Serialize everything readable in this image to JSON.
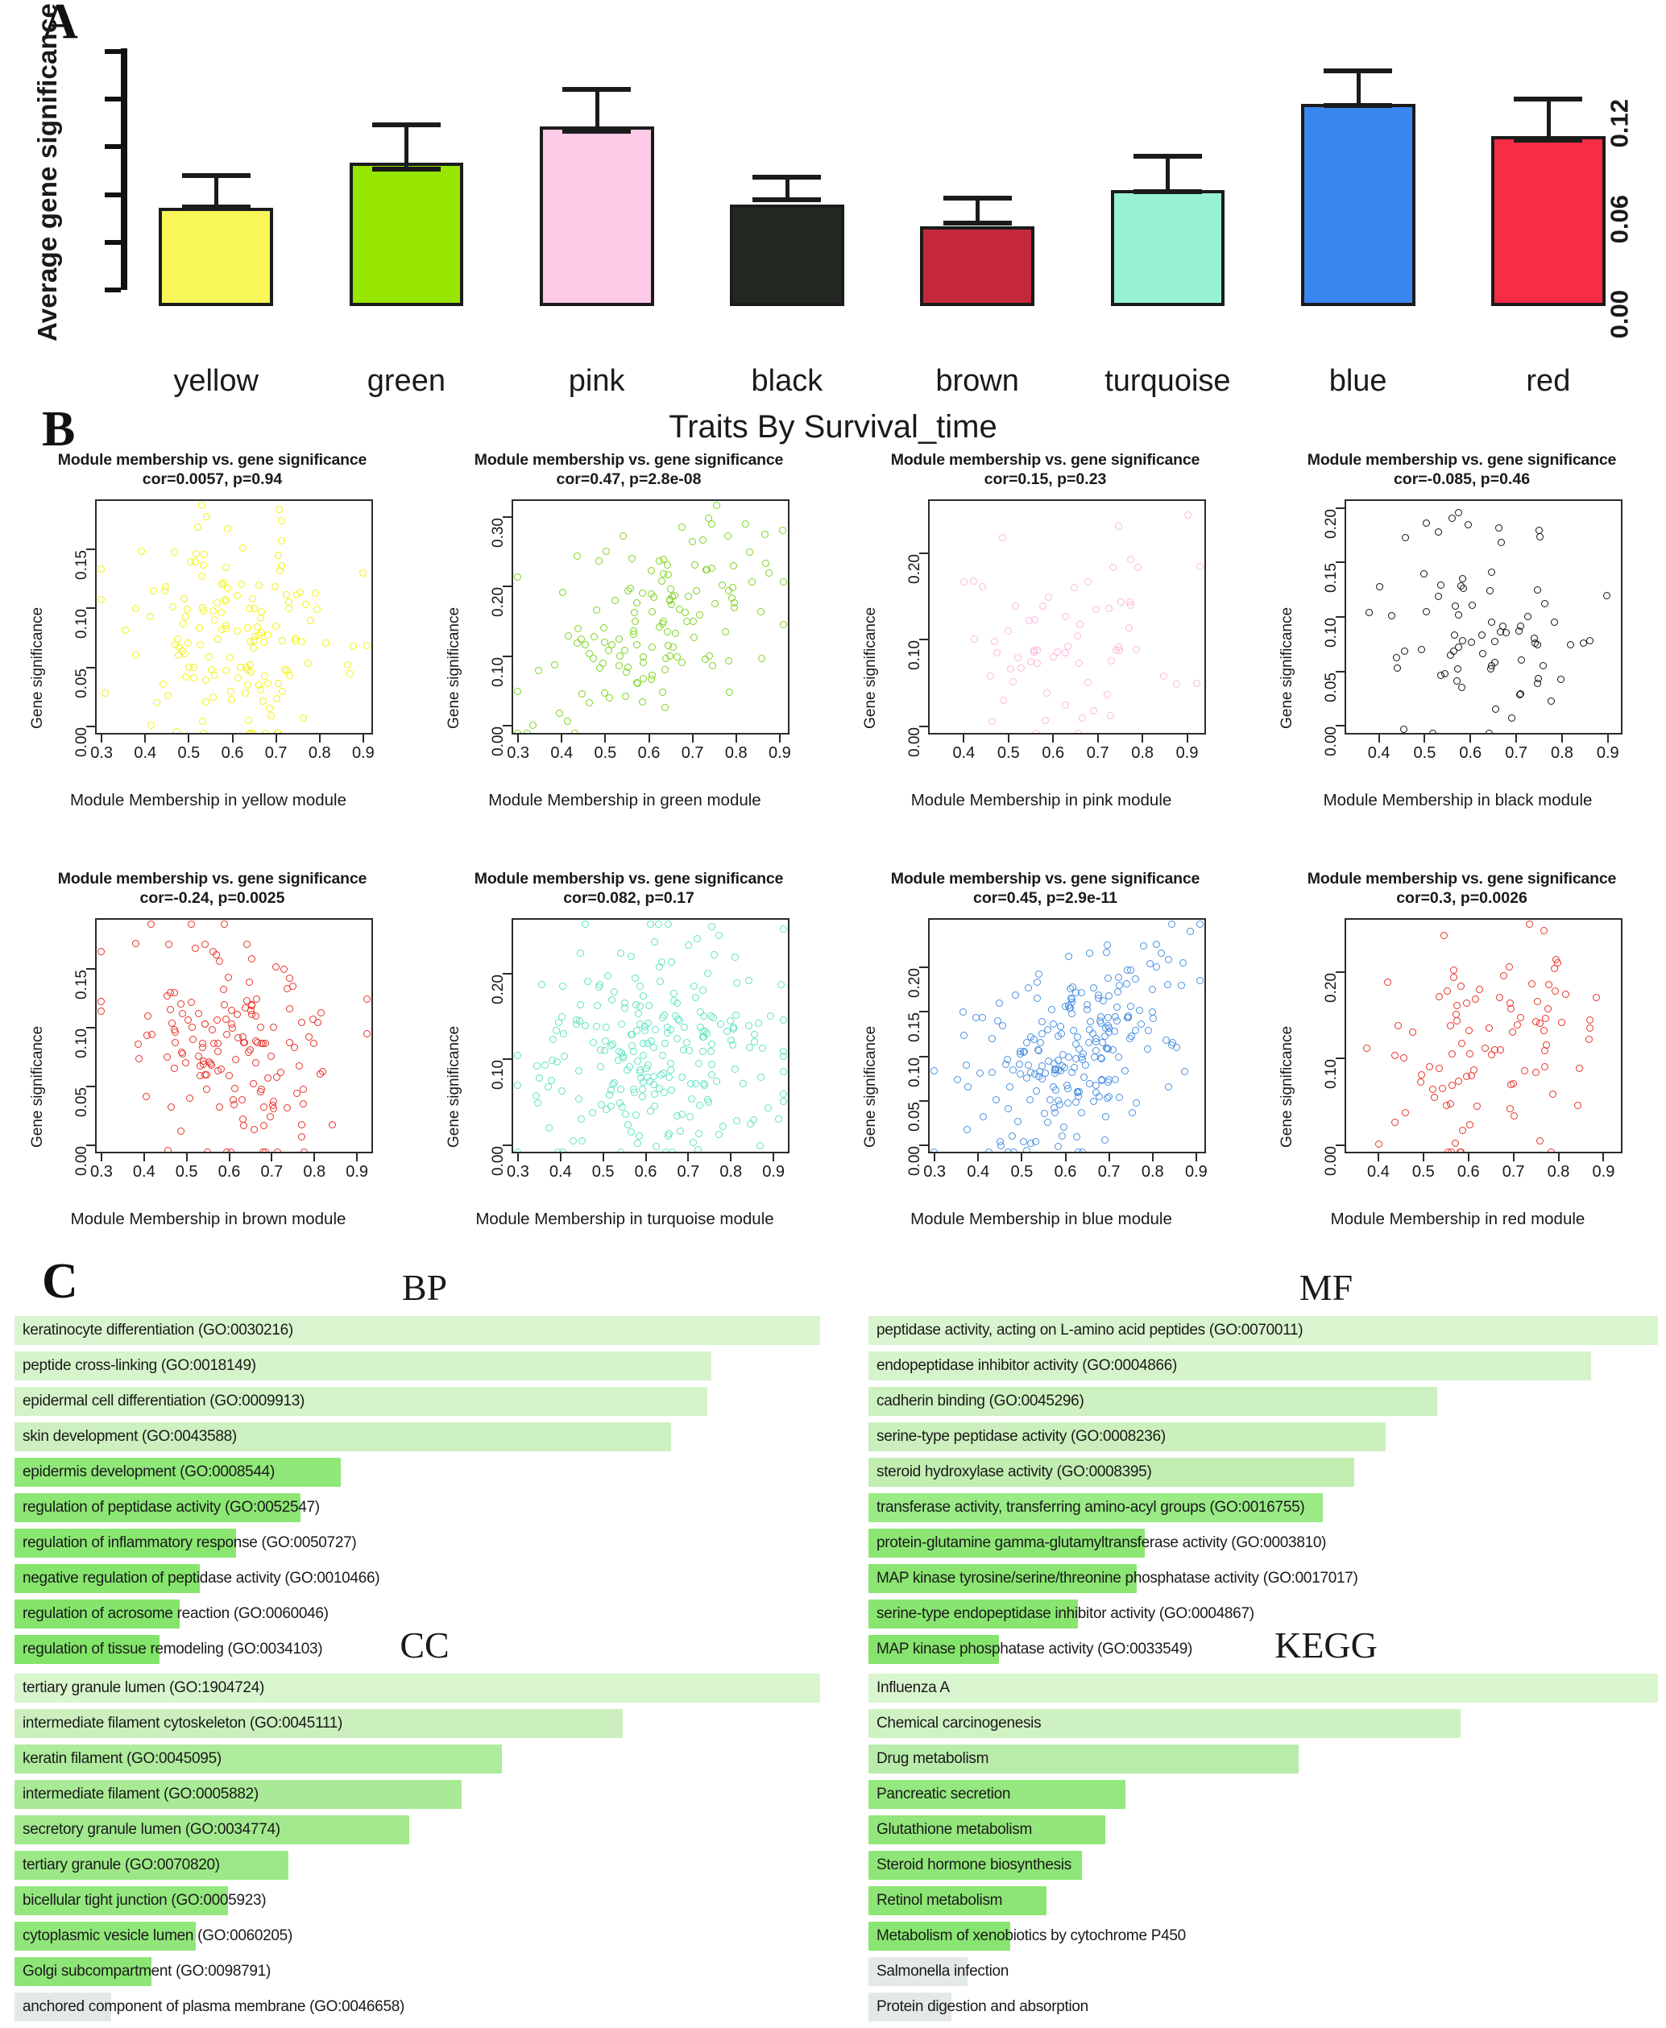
{
  "panelA": {
    "letter": "A",
    "ylabel": "Average gene significance",
    "yticks": [
      "0.00",
      "0.06",
      "0.12"
    ],
    "chart_data": {
      "type": "bar",
      "title": "",
      "xlabel": "",
      "ylabel": "Average gene significance",
      "categories": [
        "yellow",
        "green",
        "pink",
        "black",
        "brown",
        "turquoise",
        "blue",
        "red"
      ],
      "values": [
        0.062,
        0.09,
        0.113,
        0.064,
        0.05,
        0.073,
        0.127,
        0.107
      ],
      "errors": [
        0.01,
        0.014,
        0.013,
        0.007,
        0.008,
        0.011,
        0.011,
        0.013
      ],
      "colors": [
        "#f7f759",
        "#96e600",
        "#fbcbe8",
        "#232823",
        "#c5283a",
        "#96f2d3",
        "#3a86f0",
        "#f72c45"
      ],
      "ylim": [
        0,
        0.152
      ],
      "yticks": [
        0.0,
        0.06,
        0.12
      ],
      "grid": false
    }
  },
  "panelB": {
    "letter": "B",
    "title": "Traits By Survival_time",
    "plots": [
      {
        "title": "Module membership vs. gene significance",
        "subtitle": "cor=0.0057, p=0.94",
        "xlabel": "Module Membership in yellow module",
        "ylabel": "Gene significance",
        "module": "yellow",
        "color": "#f2f20f",
        "cor": 0.0057,
        "p": "0.94",
        "xticks": [
          "0.3",
          "0.4",
          "0.5",
          "0.6",
          "0.7",
          "0.8",
          "0.9"
        ],
        "yticks": [
          "0.00",
          "0.05",
          "0.10",
          "0.15"
        ],
        "xlim": [
          0.285,
          0.915
        ],
        "ylim": [
          -0.004,
          0.192
        ],
        "n": 150
      },
      {
        "title": "Module membership vs. gene significance",
        "subtitle": "cor=0.47, p=2.8e-08",
        "xlabel": "Module Membership in green module",
        "ylabel": "Gene significance",
        "module": "green",
        "color": "#7ed321",
        "cor": 0.47,
        "p": "2.8e-08",
        "xticks": [
          "0.3",
          "0.4",
          "0.5",
          "0.6",
          "0.7",
          "0.8",
          "0.9"
        ],
        "yticks": [
          "0.00",
          "0.10",
          "0.20",
          "0.30"
        ],
        "xlim": [
          0.285,
          0.915
        ],
        "ylim": [
          -0.008,
          0.325
        ],
        "n": 135
      },
      {
        "title": "Module membership vs. gene significance",
        "subtitle": "cor=0.15, p=0.23",
        "xlabel": "Module Membership in pink module",
        "ylabel": "Gene significance",
        "module": "pink",
        "color": "#ffb6d9",
        "cor": 0.15,
        "p": "0.23",
        "xticks": [
          "0.4",
          "0.5",
          "0.6",
          "0.7",
          "0.8",
          "0.9"
        ],
        "yticks": [
          "0.00",
          "0.10",
          "0.20"
        ],
        "xlim": [
          0.32,
          0.935
        ],
        "ylim": [
          -0.006,
          0.262
        ],
        "n": 65
      },
      {
        "title": "Module membership vs. gene significance",
        "subtitle": "cor=-0.085, p=0.46",
        "xlabel": "Module Membership in black module",
        "ylabel": "Gene significance",
        "module": "black",
        "color": "#111111",
        "cor": -0.085,
        "p": "0.46",
        "xticks": [
          "0.4",
          "0.5",
          "0.6",
          "0.7",
          "0.8",
          "0.9"
        ],
        "yticks": [
          "0.00",
          "0.05",
          "0.10",
          "0.15",
          "0.20"
        ],
        "xlim": [
          0.325,
          0.925
        ],
        "ylim": [
          -0.005,
          0.208
        ],
        "n": 76
      },
      {
        "title": "Module membership vs. gene significance",
        "subtitle": "cor=-0.24, p=0.0025",
        "xlabel": "Module Membership in brown module",
        "ylabel": "Gene significance",
        "module": "brown",
        "color": "#e8332a",
        "cor": -0.24,
        "p": "0.0025",
        "xticks": [
          "0.3",
          "0.4",
          "0.5",
          "0.6",
          "0.7",
          "0.8",
          "0.9"
        ],
        "yticks": [
          "0.00",
          "0.05",
          "0.10",
          "0.15"
        ],
        "xlim": [
          0.285,
          0.93
        ],
        "ylim": [
          -0.004,
          0.193
        ],
        "n": 155
      },
      {
        "title": "Module membership vs. gene significance",
        "subtitle": "cor=0.082, p=0.17",
        "xlabel": "Module Membership in turquoise module",
        "ylabel": "Gene significance",
        "module": "turquoise",
        "color": "#5fe3c0",
        "cor": 0.082,
        "p": "0.17",
        "xticks": [
          "0.3",
          "0.4",
          "0.5",
          "0.6",
          "0.7",
          "0.8",
          "0.9"
        ],
        "yticks": [
          "0.00",
          "0.10",
          "0.20"
        ],
        "xlim": [
          0.285,
          0.93
        ],
        "ylim": [
          -0.006,
          0.265
        ],
        "n": 240
      },
      {
        "title": "Module membership vs. gene significance",
        "subtitle": "cor=0.45, p=2.9e-11",
        "xlabel": "Module Membership in blue module",
        "ylabel": "Gene significance",
        "module": "blue",
        "color": "#4a90e2",
        "cor": 0.45,
        "p": "2.9e-11",
        "xticks": [
          "0.3",
          "0.4",
          "0.5",
          "0.6",
          "0.7",
          "0.8",
          "0.9"
        ],
        "yticks": [
          "0.00",
          "0.05",
          "0.10",
          "0.15",
          "0.20"
        ],
        "xlim": [
          0.285,
          0.915
        ],
        "ylim": [
          -0.005,
          0.255
        ],
        "n": 230
      },
      {
        "title": "Module membership vs. gene significance",
        "subtitle": "cor=0.3, p=0.0026",
        "xlabel": "Module Membership in red module",
        "ylabel": "Gene significance",
        "module": "red",
        "color": "#e8332a",
        "cor": 0.3,
        "p": "0.0026",
        "xticks": [
          "0.4",
          "0.5",
          "0.6",
          "0.7",
          "0.8",
          "0.9"
        ],
        "yticks": [
          "0.00",
          "0.10",
          "0.20"
        ],
        "xlim": [
          0.325,
          0.935
        ],
        "ylim": [
          -0.006,
          0.262
        ],
        "n": 95
      }
    ]
  },
  "panelC": {
    "letter": "C",
    "sections": [
      {
        "heading": "BP",
        "chart_data": {
          "type": "bar",
          "title": "BP",
          "categories": [
            "keratinocyte differentiation (GO:0030216)",
            "peptide cross-linking (GO:0018149)",
            "epidermal cell differentiation (GO:0009913)",
            "skin development (GO:0043588)",
            "epidermis development (GO:0008544)",
            "regulation of peptidase activity (GO:0052547)",
            "regulation of inflammatory response (GO:0050727)",
            "negative regulation of peptidase activity (GO:0010466)",
            "regulation of acrosome reaction (GO:0060046)",
            "regulation of tissue remodeling (GO:0034103)"
          ],
          "values": [
            100,
            86.5,
            86.0,
            81.5,
            40.5,
            35.5,
            27.5,
            23.0,
            20.5,
            18.0
          ],
          "colors": [
            "#d9f5cf",
            "#d6f4cb",
            "#d4f3c8",
            "#ccf0bf",
            "#90e879",
            "#8ce674",
            "#89e671",
            "#86e56d",
            "#84e46b",
            "#82e469"
          ]
        }
      },
      {
        "heading": "MF",
        "chart_data": {
          "type": "bar",
          "title": "MF",
          "categories": [
            "peptidase activity, acting on L-amino acid peptides (GO:0070011)",
            "endopeptidase inhibitor activity (GO:0004866)",
            "cadherin binding (GO:0045296)",
            "serine-type peptidase activity (GO:0008236)",
            "steroid hydroxylase activity (GO:0008395)",
            "transferase activity, transferring amino-acyl groups (GO:0016755)",
            "protein-glutamine gamma-glutamyltransferase activity (GO:0003810)",
            "MAP kinase tyrosine/serine/threonine phosphatase activity (GO:0017017)",
            "serine-type endopeptidase inhibitor activity (GO:0004867)",
            "MAP kinase phosphatase activity (GO:0033549)"
          ],
          "values": [
            100,
            91.5,
            72.0,
            65.5,
            61.5,
            57.5,
            35.0,
            34.0,
            26.5,
            16.5
          ],
          "colors": [
            "#d9f5cf",
            "#d6f4cb",
            "#cdf1c0",
            "#cbf0bd",
            "#c2eeb2",
            "#9aeb86",
            "#8ce674",
            "#8ae571",
            "#88e56f",
            "#85e46c"
          ]
        }
      },
      {
        "heading": "CC",
        "chart_data": {
          "type": "bar",
          "title": "CC",
          "categories": [
            "tertiary granule lumen (GO:1904724)",
            "intermediate filament cytoskeleton (GO:0045111)",
            "keratin filament (GO:0045095)",
            "intermediate filament (GO:0005882)",
            "secretory granule lumen (GO:0034774)",
            "tertiary granule (GO:0070820)",
            "bicellular tight junction (GO:0005923)",
            "cytoplasmic vesicle lumen (GO:0060205)",
            "Golgi subcompartment (GO:0098791)",
            "anchored component of plasma membrane (GO:0046658)"
          ],
          "values": [
            100,
            75.5,
            60.5,
            55.5,
            49.0,
            34.0,
            26.5,
            22.5,
            17.0,
            12.0
          ],
          "colors": [
            "#d8f5ce",
            "#cbf0bd",
            "#aeeb9c",
            "#a9ea96",
            "#a2e98e",
            "#9ce887",
            "#94e77e",
            "#91e67a",
            "#8ee577",
            "#e3e9e7"
          ]
        }
      },
      {
        "heading": "KEGG",
        "chart_data": {
          "type": "bar",
          "title": "KEGG",
          "categories": [
            "Influenza A",
            "Chemical carcinogenesis",
            "Drug metabolism",
            "Pancreatic secretion",
            "Glutathione metabolism",
            "Steroid hormone biosynthesis",
            "Retinol metabolism",
            "Metabolism of xenobiotics by cytochrome P450",
            "Salmonella infection",
            "Protein digestion and absorption"
          ],
          "values": [
            100,
            75.0,
            54.5,
            32.5,
            30.0,
            27.0,
            22.5,
            18.0,
            12.5,
            10.5
          ],
          "colors": [
            "#d9f5cf",
            "#cff2c2",
            "#b9ecab",
            "#95e77f",
            "#92e67b",
            "#8fe678",
            "#8ce574",
            "#89e571",
            "#e3e9e7",
            "#e3e9e7"
          ]
        }
      }
    ]
  }
}
